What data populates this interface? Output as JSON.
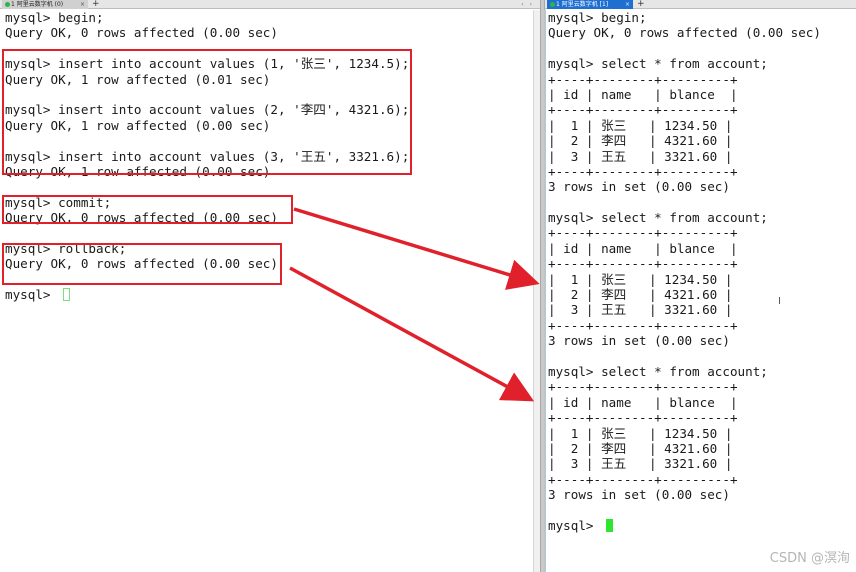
{
  "left_tab": {
    "label": "1 阿里云数字机 (0)",
    "close": "×",
    "add": "+",
    "nav": "‹ ›"
  },
  "right_tab": {
    "label": "1 阿里云数字机 [1]",
    "close": "×",
    "add": "+"
  },
  "left_terminal": {
    "lines": [
      "mysql> begin;",
      "Query OK, 0 rows affected (0.00 sec)",
      "",
      "mysql> insert into account values (1, '张三', 1234.5);",
      "Query OK, 1 row affected (0.01 sec)",
      "",
      "mysql> insert into account values (2, '李四', 4321.6);",
      "Query OK, 1 row affected (0.00 sec)",
      "",
      "mysql> insert into account values (3, '王五', 3321.6);",
      "Query OK, 1 row affected (0.00 sec)",
      "",
      "mysql> commit;",
      "Query OK, 0 rows affected (0.00 sec)",
      "",
      "mysql> rollback;",
      "Query OK, 0 rows affected (0.00 sec)",
      "",
      "mysql> "
    ]
  },
  "right_terminal": {
    "lines": [
      "mysql> begin;",
      "Query OK, 0 rows affected (0.00 sec)",
      "",
      "mysql> select * from account;",
      "+----+--------+---------+",
      "| id | name   | blance  |",
      "+----+--------+---------+",
      "|  1 | 张三   | 1234.50 |",
      "|  2 | 李四   | 4321.60 |",
      "|  3 | 王五   | 3321.60 |",
      "+----+--------+---------+",
      "3 rows in set (0.00 sec)",
      "",
      "mysql> select * from account;",
      "+----+--------+---------+",
      "| id | name   | blance  |",
      "+----+--------+---------+",
      "|  1 | 张三   | 1234.50 |",
      "|  2 | 李四   | 4321.60 |",
      "|  3 | 王五   | 3321.60 |",
      "+----+--------+---------+",
      "3 rows in set (0.00 sec)",
      "",
      "mysql> select * from account;",
      "+----+--------+---------+",
      "| id | name   | blance  |",
      "+----+--------+---------+",
      "|  1 | 张三   | 1234.50 |",
      "|  2 | 李四   | 4321.60 |",
      "|  3 | 王五   | 3321.60 |",
      "+----+--------+---------+",
      "3 rows in set (0.00 sec)",
      "",
      "mysql> "
    ]
  },
  "watermark": "CSDN @溟洵",
  "colors": {
    "annotation": "#e0212b",
    "cursor_active": "#2ee62e",
    "cursor_inactive": "#7ddf7d",
    "active_tab": "#1f6fd1"
  }
}
